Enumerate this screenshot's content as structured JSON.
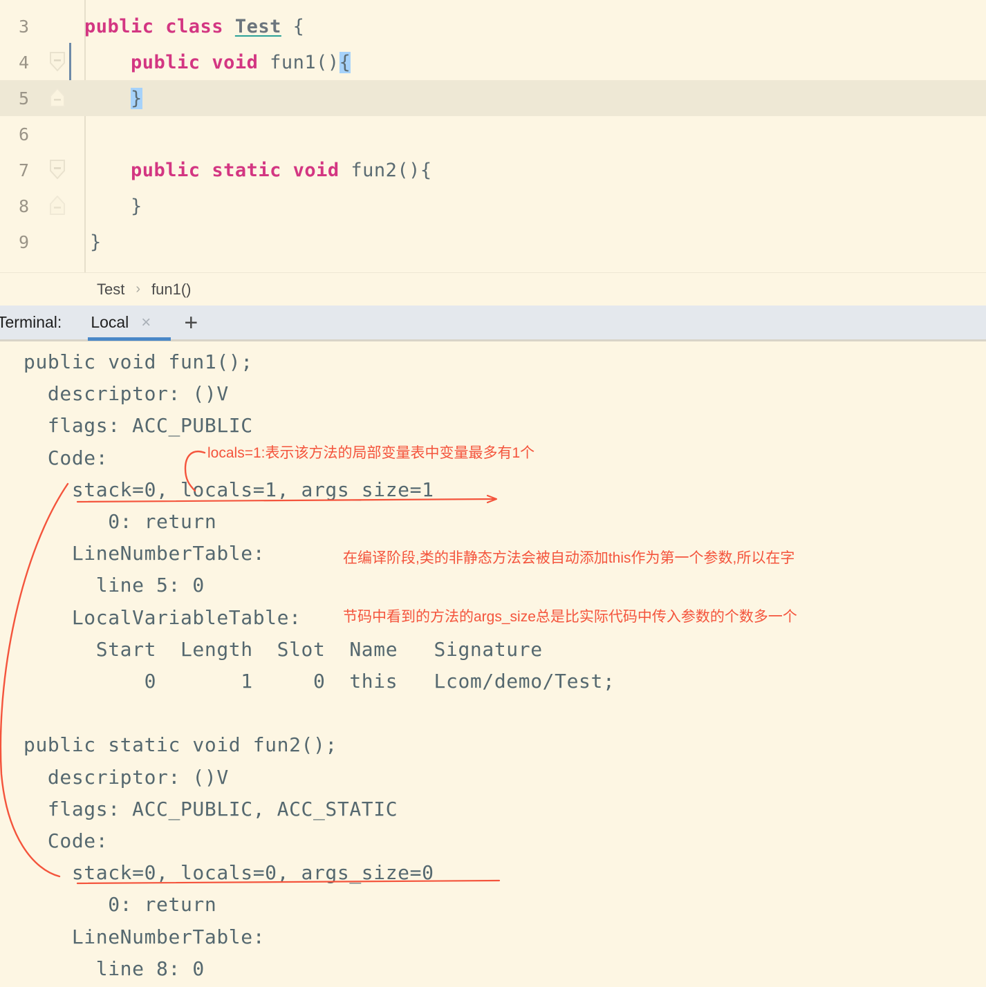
{
  "editor": {
    "lines": [
      {
        "number": "3",
        "indent": 0,
        "fold": "none"
      },
      {
        "number": "4",
        "indent": 0,
        "fold": "open"
      },
      {
        "number": "5",
        "indent": 0,
        "fold": "close",
        "current": true
      },
      {
        "number": "6",
        "indent": 0,
        "fold": "none"
      },
      {
        "number": "7",
        "indent": 0,
        "fold": "open"
      },
      {
        "number": "8",
        "indent": 0,
        "fold": "close"
      },
      {
        "number": "9",
        "indent": 0,
        "fold": "none"
      }
    ],
    "line3": {
      "kw1": "public class",
      "cls": "Test",
      "rest": " {"
    },
    "line4": {
      "pre": "    ",
      "kw": "public void",
      "name": " fun1()",
      "brace": "{"
    },
    "line5": {
      "brace": "}"
    },
    "line7": {
      "pre": "    ",
      "kw": "public static void",
      "name": " fun2(){"
    },
    "line8": {
      "text": "    }"
    },
    "line9": {
      "text": "}"
    }
  },
  "breadcrumb": {
    "class": "Test",
    "separator": "›",
    "method": "fun1()"
  },
  "terminal_tabbar": {
    "label": "Terminal:",
    "tab_label": "Local",
    "close_icon": "×",
    "add_icon": "+"
  },
  "terminal_output": {
    "text": "public void fun1();\n  descriptor: ()V\n  flags: ACC_PUBLIC\n  Code:\n    stack=0, locals=1, args_size=1\n       0: return\n    LineNumberTable:\n      line 5: 0\n    LocalVariableTable:\n      Start  Length  Slot  Name   Signature\n          0       1     0  this   Lcom/demo/Test;\n\npublic static void fun2();\n  descriptor: ()V\n  flags: ACC_PUBLIC, ACC_STATIC\n  Code:\n    stack=0, locals=0, args_size=0\n       0: return\n    LineNumberTable:\n      line 8: 0"
  },
  "annotations": {
    "locals_note": "locals=1:表示该方法的局部变量表中变量最多有1个",
    "args_note_line1": "在编译阶段,类的非静态方法会被自动添加this作为第一个参数,所以在字",
    "args_note_line2": "节码中看到的方法的args_size总是比实际代码中传入参数的个数多一个"
  },
  "colors": {
    "editor_bg": "#FDF6E3",
    "current_line_bg": "#EEE8D5",
    "keyword": "#D33682",
    "code_text": "#5B6B72",
    "selection": "#A6D2FA",
    "annotation_red": "#F4543C",
    "tabbar_bg": "#E4E8ED",
    "tab_active_underline": "#4A88C7",
    "class_underline": "#2AA198"
  }
}
